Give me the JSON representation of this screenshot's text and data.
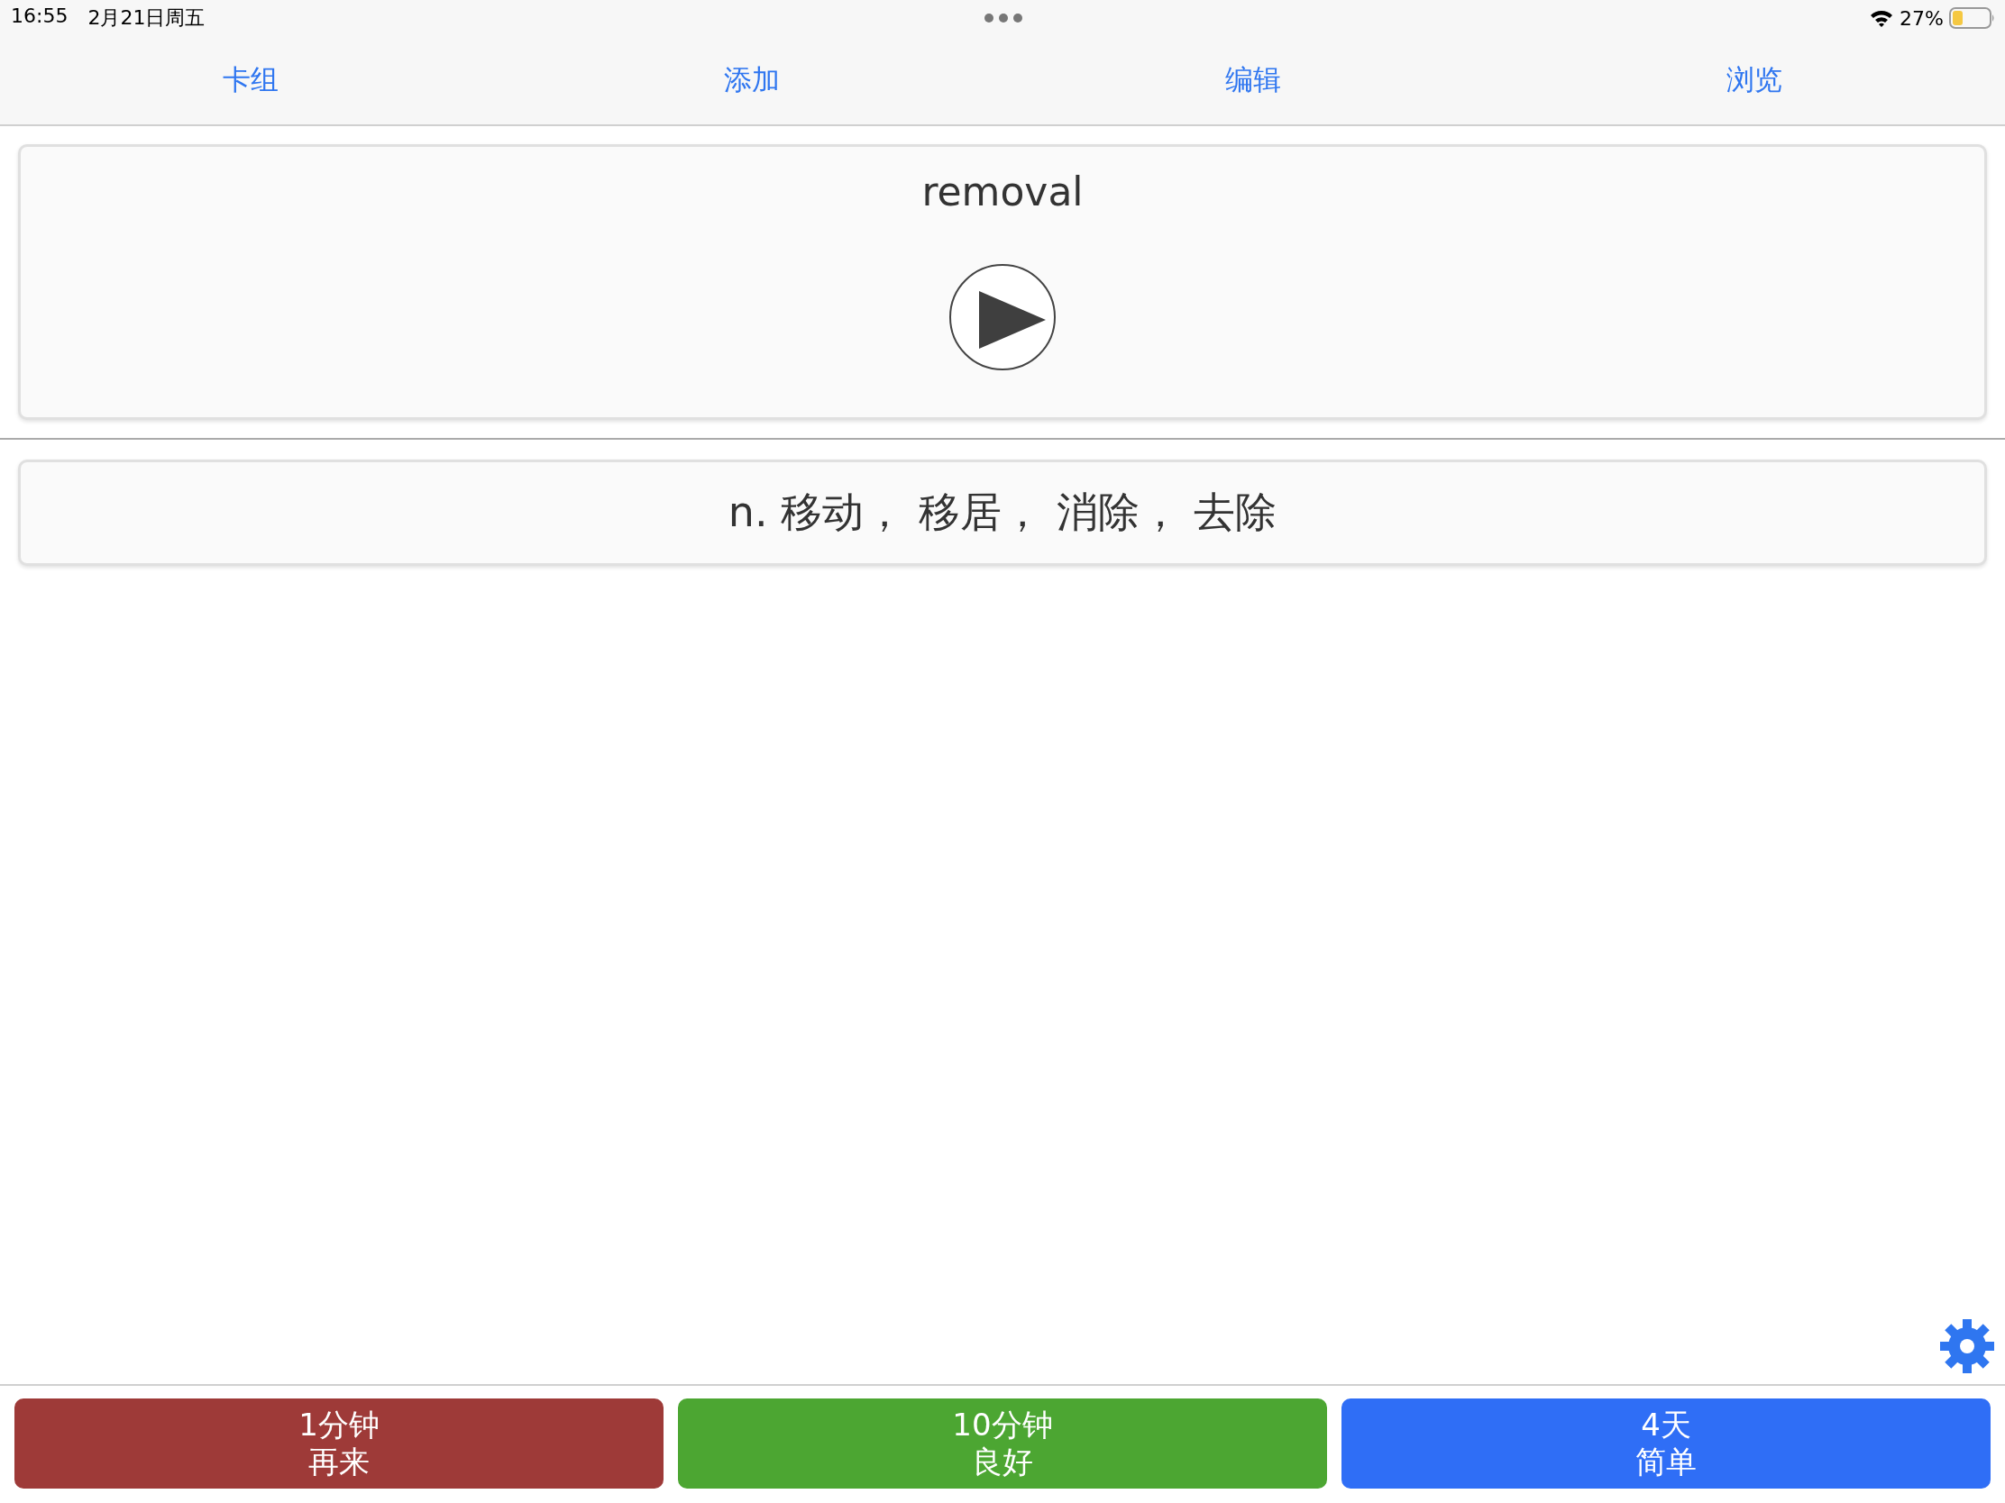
{
  "status_bar": {
    "time": "16:55",
    "date": "2月21日周五",
    "battery_percent": "27%"
  },
  "tabs": [
    {
      "label": "卡组"
    },
    {
      "label": "添加"
    },
    {
      "label": "编辑"
    },
    {
      "label": "浏览"
    }
  ],
  "question": {
    "word": "removal"
  },
  "answer": {
    "text": "n. 移动， 移居， 消除， 去除"
  },
  "answer_buttons": [
    {
      "interval": "1分钟",
      "label": "再来",
      "color": "#9e3a38"
    },
    {
      "interval": "10分钟",
      "label": "良好",
      "color": "#4ca632"
    },
    {
      "interval": "4天",
      "label": "简单",
      "color": "#2f6ef6"
    }
  ]
}
